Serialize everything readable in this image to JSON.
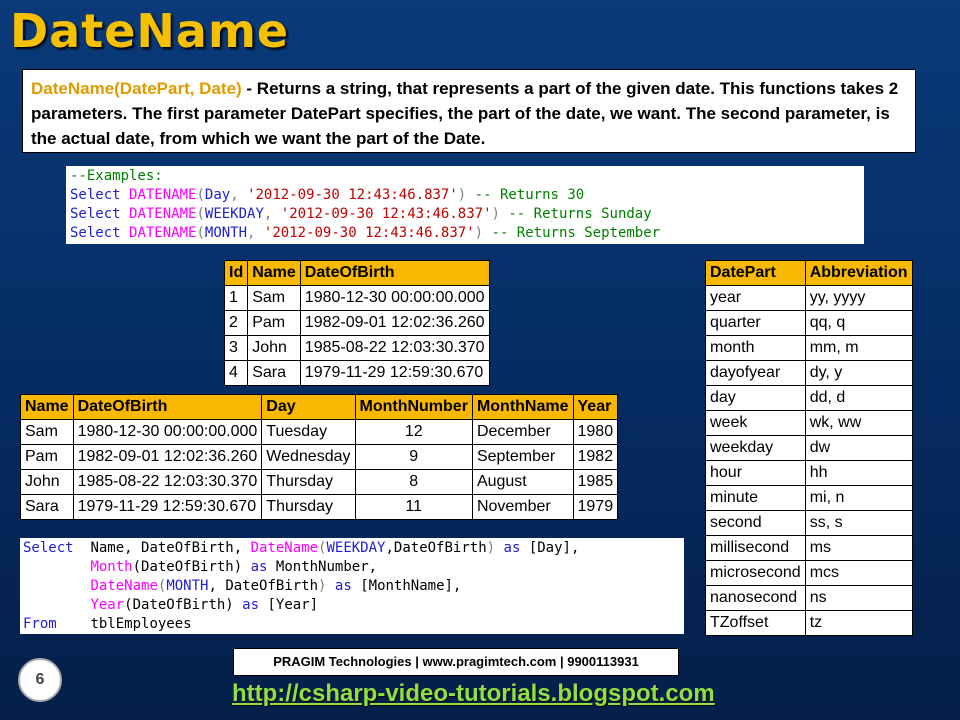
{
  "title": "DateName",
  "description": {
    "function_signature": "DateName(DatePart, Date)",
    "text": " - Returns a string, that represents a part of the given date. This functions takes 2 parameters. The first parameter DatePart specifies, the part of the date, we want. The second parameter, is the actual date, from which we want the part of the Date."
  },
  "examples": {
    "comment": "--Examples:",
    "lines": [
      {
        "select": "Select",
        "fn": "DATENAME",
        "part": "Day",
        "value": "'2012-09-30 12:43:46.837'",
        "comment": "-- Returns 30"
      },
      {
        "select": "Select",
        "fn": "DATENAME",
        "part": "WEEKDAY",
        "value": "'2012-09-30 12:43:46.837'",
        "comment": "-- Returns Sunday"
      },
      {
        "select": "Select",
        "fn": "DATENAME",
        "part": "MONTH",
        "value": "'2012-09-30 12:43:46.837'",
        "comment": "-- Returns September"
      }
    ]
  },
  "employees_table": {
    "headers": [
      "Id",
      "Name",
      "DateOfBirth"
    ],
    "rows": [
      [
        "1",
        "Sam",
        "1980-12-30 00:00:00.000"
      ],
      [
        "2",
        "Pam",
        "1982-09-01 12:02:36.260"
      ],
      [
        "3",
        "John",
        "1985-08-22 12:03:30.370"
      ],
      [
        "4",
        "Sara",
        "1979-11-29 12:59:30.670"
      ]
    ]
  },
  "result_table": {
    "headers": [
      "Name",
      "DateOfBirth",
      "Day",
      "MonthNumber",
      "MonthName",
      "Year"
    ],
    "rows": [
      [
        "Sam",
        "1980-12-30 00:00:00.000",
        "Tuesday",
        "12",
        "December",
        "1980"
      ],
      [
        "Pam",
        "1982-09-01 12:02:36.260",
        "Wednesday",
        "9",
        "September",
        "1982"
      ],
      [
        "John",
        "1985-08-22 12:03:30.370",
        "Thursday",
        "8",
        "August",
        "1985"
      ],
      [
        "Sara",
        "1979-11-29 12:59:30.670",
        "Thursday",
        "11",
        "November",
        "1979"
      ]
    ]
  },
  "datepart_table": {
    "headers": [
      "DatePart",
      "Abbreviation"
    ],
    "rows": [
      [
        "year",
        "yy, yyyy"
      ],
      [
        "quarter",
        "qq, q"
      ],
      [
        "month",
        "mm, m"
      ],
      [
        "dayofyear",
        "dy, y"
      ],
      [
        "day",
        "dd, d"
      ],
      [
        "week",
        "wk, ww"
      ],
      [
        "weekday",
        "dw"
      ],
      [
        "hour",
        "hh"
      ],
      [
        "minute",
        "mi, n"
      ],
      [
        "second",
        "ss, s"
      ],
      [
        "millisecond",
        "ms"
      ],
      [
        "microsecond",
        "mcs"
      ],
      [
        "nanosecond",
        "ns"
      ],
      [
        "TZoffset",
        "tz"
      ]
    ]
  },
  "query": {
    "select": "Select",
    "l1_cols": "Name, DateOfBirth, ",
    "datename": "DateName",
    "weekday": "WEEKDAY",
    "l1_arg": ",DateOfBirth",
    "as": "as",
    "day_alias": "[Day],",
    "month_fn": "Month",
    "l2_arg": "(DateOfBirth) ",
    "month_alias": "MonthNumber,",
    "month_part": "MONTH",
    "l3_arg": ", DateOfBirth",
    "monthname_alias": "[MonthName],",
    "year_fn": "Year",
    "year_alias": "[Year]",
    "from": "From",
    "table": "tblEmployees"
  },
  "footer": {
    "brand": "PRAGIM Technologies | www.pragimtech.com | 9900113931",
    "page_number": "6",
    "url": "http://csharp-video-tutorials.blogspot.com"
  }
}
